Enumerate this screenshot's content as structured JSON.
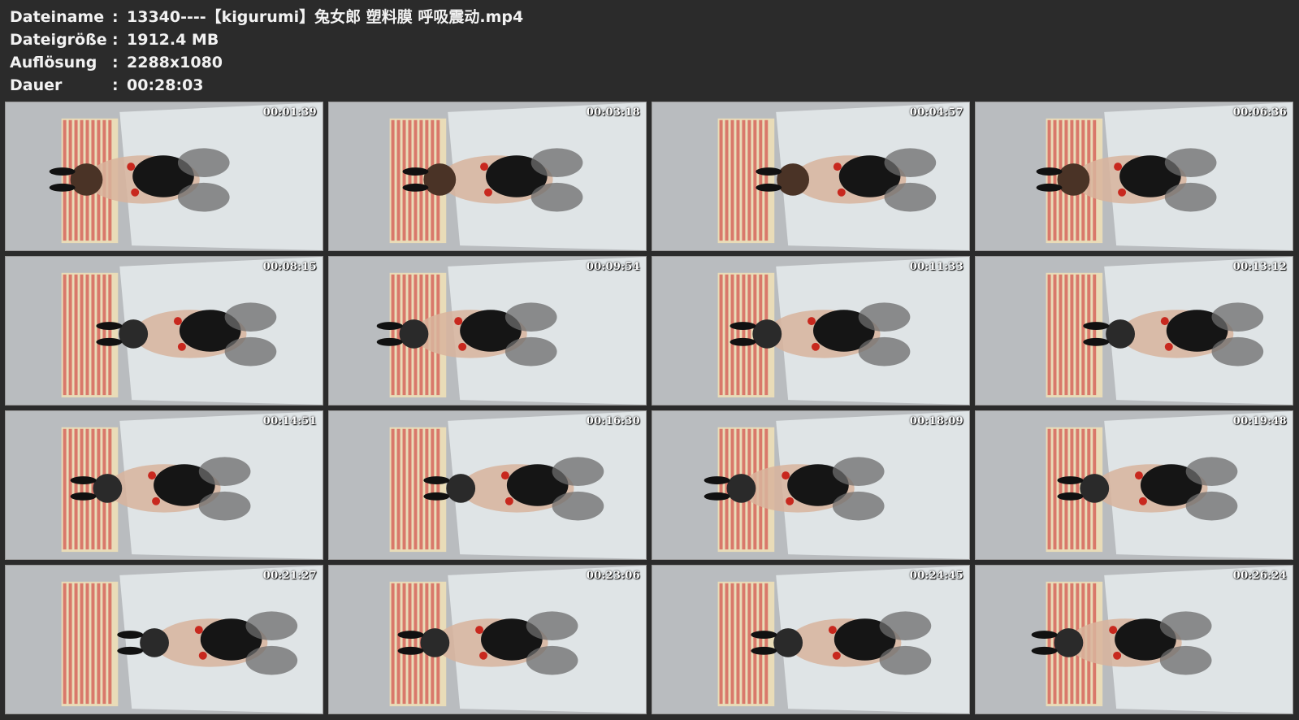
{
  "info": {
    "rows": [
      {
        "label": "Dateiname",
        "sep": ":",
        "value": "13340----【kigurumi】兔女郎 塑料膜 呼吸震动.mp4"
      },
      {
        "label": "Dateigröße",
        "sep": ":",
        "value": "1912.4 MB"
      },
      {
        "label": "Auflösung",
        "sep": ":",
        "value": "2288x1080"
      },
      {
        "label": "Dauer",
        "sep": ":",
        "value": "00:28:03"
      }
    ]
  },
  "thumbnails": [
    {
      "timestamp": "00:01:39"
    },
    {
      "timestamp": "00:03:18"
    },
    {
      "timestamp": "00:04:57"
    },
    {
      "timestamp": "00:06:36"
    },
    {
      "timestamp": "00:08:15"
    },
    {
      "timestamp": "00:09:54"
    },
    {
      "timestamp": "00:11:33"
    },
    {
      "timestamp": "00:13:12"
    },
    {
      "timestamp": "00:14:51"
    },
    {
      "timestamp": "00:16:30"
    },
    {
      "timestamp": "00:18:09"
    },
    {
      "timestamp": "00:19:48"
    },
    {
      "timestamp": "00:21:27"
    },
    {
      "timestamp": "00:23:06"
    },
    {
      "timestamp": "00:24:45"
    },
    {
      "timestamp": "00:26:24"
    }
  ],
  "colors": {
    "background": "#2b2b2b",
    "text": "#f2f2f2",
    "floor": "#b9bcbf",
    "sheet": "#dfe4e6",
    "stripe_red": "#d9786a",
    "stripe_cream": "#e9dcb8",
    "outfit": "#151515",
    "skin": "#d8b49c",
    "cuff": "#c8281e"
  }
}
